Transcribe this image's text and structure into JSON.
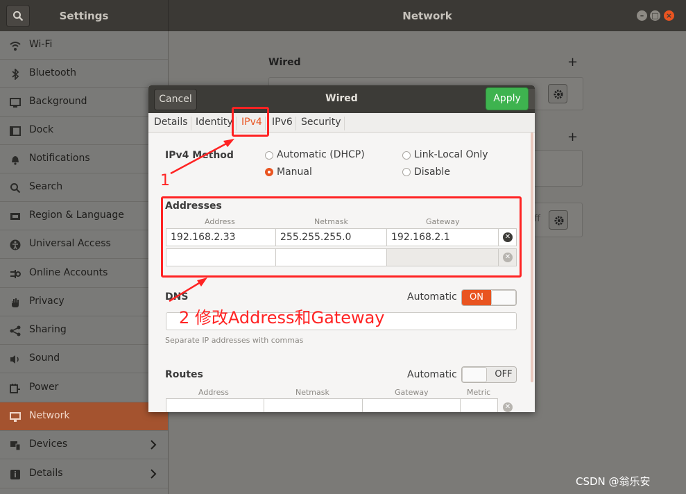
{
  "header": {
    "sidebar_title": "Settings",
    "window_title": "Network",
    "window_controls": [
      "minimize",
      "maximize",
      "close"
    ]
  },
  "sidebar": {
    "items": [
      {
        "label": "Wi-Fi",
        "icon": "wifi-icon"
      },
      {
        "label": "Bluetooth",
        "icon": "bluetooth-icon"
      },
      {
        "label": "Background",
        "icon": "background-icon"
      },
      {
        "label": "Dock",
        "icon": "dock-icon"
      },
      {
        "label": "Notifications",
        "icon": "bell-icon"
      },
      {
        "label": "Search",
        "icon": "search-icon"
      },
      {
        "label": "Region & Language",
        "icon": "region-icon"
      },
      {
        "label": "Universal Access",
        "icon": "accessibility-icon"
      },
      {
        "label": "Online Accounts",
        "icon": "online-accounts-icon"
      },
      {
        "label": "Privacy",
        "icon": "hand-icon"
      },
      {
        "label": "Sharing",
        "icon": "share-icon"
      },
      {
        "label": "Sound",
        "icon": "speaker-icon"
      },
      {
        "label": "Power",
        "icon": "power-icon"
      },
      {
        "label": "Network",
        "icon": "network-icon",
        "active": true
      },
      {
        "label": "Devices",
        "icon": "devices-icon",
        "has_chevron": true
      },
      {
        "label": "Details",
        "icon": "details-icon",
        "has_chevron": true
      }
    ]
  },
  "background": {
    "wired_label": "Wired",
    "off_fragment": "ff"
  },
  "dialog": {
    "title": "Wired",
    "cancel_label": "Cancel",
    "apply_label": "Apply",
    "tabs": [
      "Details",
      "Identity",
      "IPv4",
      "IPv6",
      "Security"
    ],
    "active_tab": "IPv4",
    "method": {
      "label": "IPv4 Method",
      "options": [
        "Automatic (DHCP)",
        "Link-Local Only",
        "Manual",
        "Disable"
      ],
      "selected": "Manual"
    },
    "addresses": {
      "label": "Addresses",
      "columns": [
        "Address",
        "Netmask",
        "Gateway"
      ],
      "rows": [
        {
          "address": "192.168.2.33",
          "netmask": "255.255.255.0",
          "gateway": "192.168.2.1"
        },
        {
          "address": "",
          "netmask": "",
          "gateway": ""
        }
      ]
    },
    "dns": {
      "label": "DNS",
      "automatic_label": "Automatic",
      "toggle": "ON",
      "value": "",
      "hint": "Separate IP addresses with commas"
    },
    "routes": {
      "label": "Routes",
      "automatic_label": "Automatic",
      "toggle": "OFF",
      "columns": [
        "Address",
        "Netmask",
        "Gateway",
        "Metric"
      ]
    }
  },
  "annotations": {
    "step1": "1",
    "step2": "2 修改Address和Gateway"
  },
  "watermark": "CSDN @翁乐安",
  "colors": {
    "accent": "#e95420",
    "annotation": "#ff2323",
    "apply": "#3eb34f"
  }
}
